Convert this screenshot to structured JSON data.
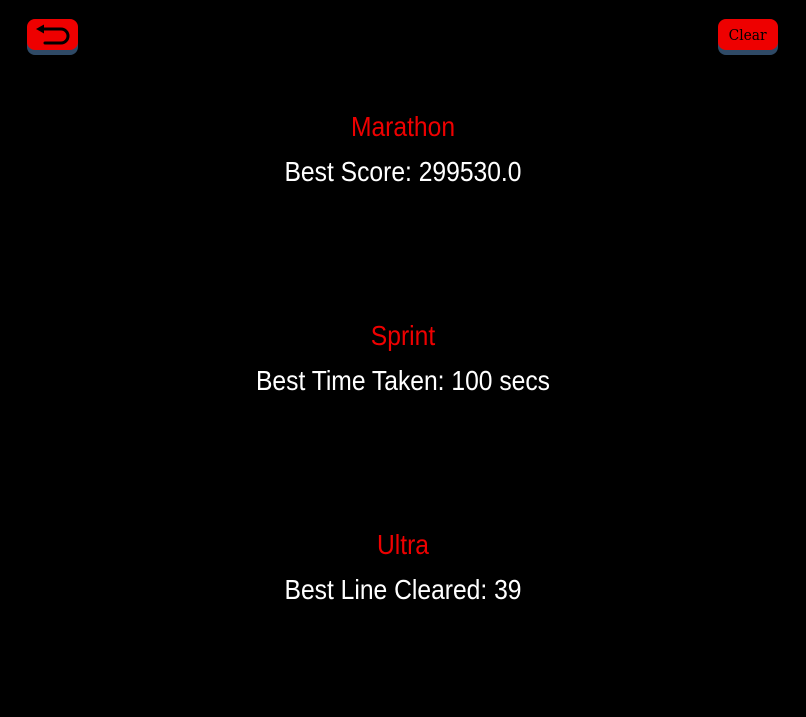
{
  "toolbar": {
    "back_icon": "undo-arrow-icon",
    "clear_label": "Clear"
  },
  "colors": {
    "background": "#000000",
    "accent": "#ee0000",
    "button_shadow": "#2f4a66",
    "text": "#ffffff"
  },
  "modes": [
    {
      "title": "Marathon",
      "stat": "Best Score: 299530.0"
    },
    {
      "title": "Sprint",
      "stat": "Best Time Taken: 100 secs"
    },
    {
      "title": "Ultra",
      "stat": "Best Line Cleared: 39"
    }
  ]
}
